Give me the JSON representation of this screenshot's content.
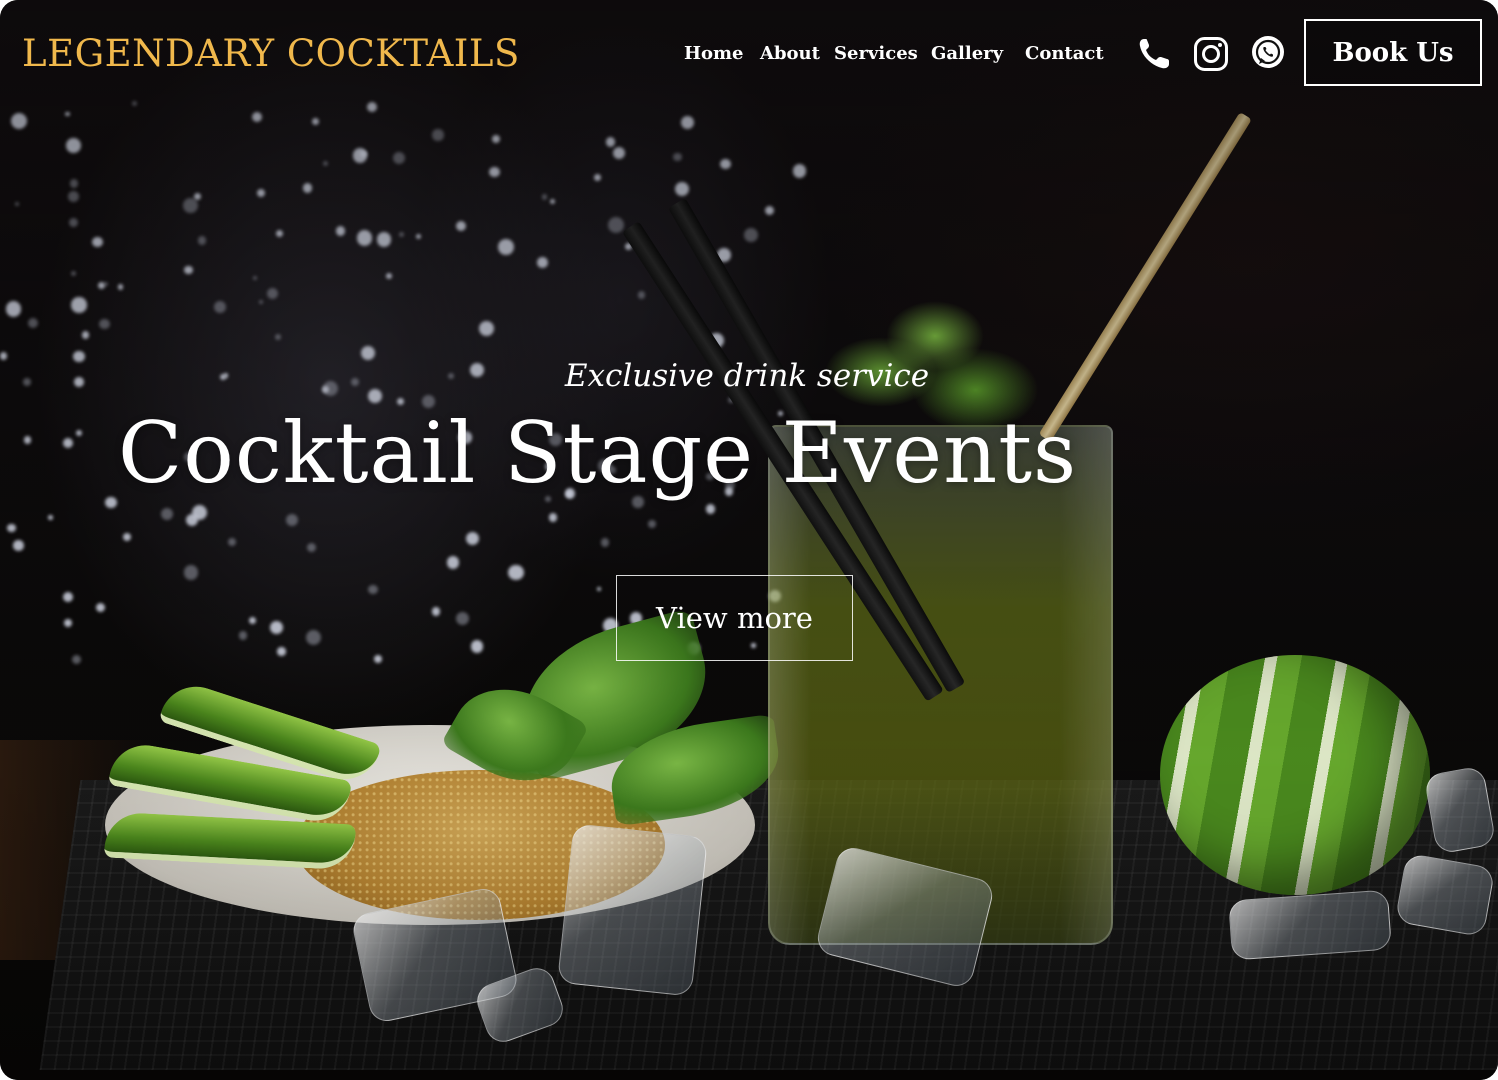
{
  "header": {
    "brand": "LEGENDARY COCKTAILS",
    "nav": [
      "Home",
      "About",
      "Services",
      "Gallery",
      "Contact"
    ],
    "icons": [
      "phone-icon",
      "instagram-icon",
      "whatsapp-icon"
    ],
    "book_button": "Book Us"
  },
  "hero": {
    "subtitle": "Exclusive drink service",
    "title": "Cocktail Stage Events",
    "cta": "View more"
  },
  "colors": {
    "brand": "#f0b84c",
    "text": "#ffffff",
    "background": "#0b0908"
  }
}
